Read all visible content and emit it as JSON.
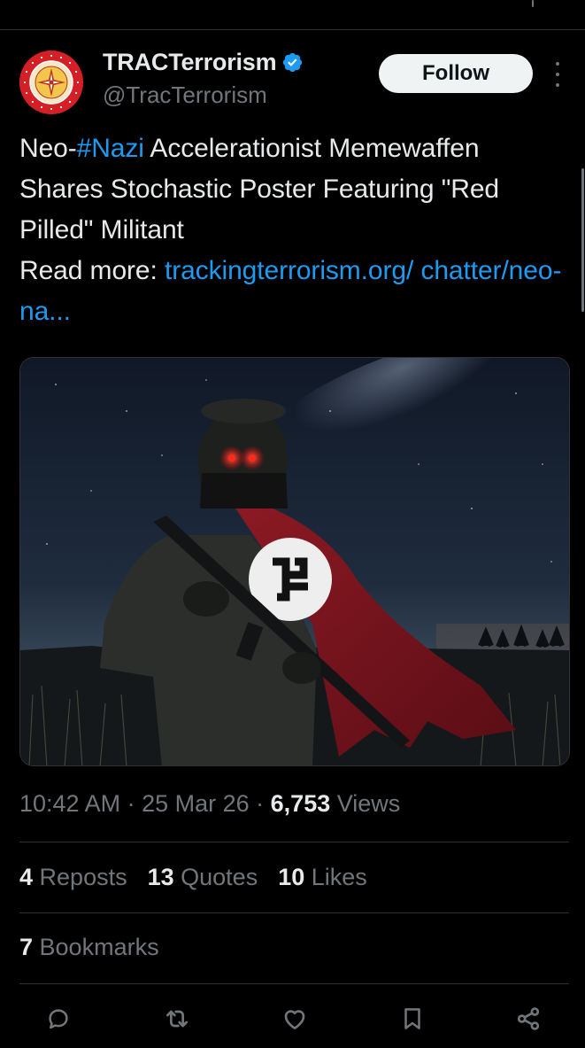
{
  "post": {
    "author": {
      "display_name": "TRACTerrorism",
      "handle": "@TracTerrorism",
      "verified": true,
      "avatar_icon": "trac-seal-logo",
      "avatar_ring_text": "TERRORISM RESEARCH & ANALYSIS CONSORTIUM"
    },
    "follow_label": "Follow",
    "more_icon": "more-vertical-icon",
    "text": {
      "prefix": "Neo-",
      "hashtag": "#Nazi",
      "body": " Accelerationist Memewaffen Shares Stochastic Poster Featuring \"Red Pilled\" Militant",
      "read_more": "Read more:",
      "link_display": "trackingterrorism.org/ chatter/neo-na..."
    },
    "media": {
      "kind": "image"
    },
    "meta": {
      "time": "10:42 AM",
      "sep1": " · ",
      "date": "25 Mar 26",
      "sep2": " · ",
      "views_count": "6,753",
      "views_label": " Views"
    },
    "stats": {
      "reposts_count": "4",
      "reposts_label": " Reposts",
      "quotes_count": "13",
      "quotes_label": " Quotes",
      "likes_count": "10",
      "likes_label": " Likes",
      "bookmarks_count": "7",
      "bookmarks_label": " Bookmarks"
    },
    "actions": [
      "reply-icon",
      "repost-icon",
      "like-icon",
      "bookmark-icon",
      "share-icon"
    ]
  },
  "colors": {
    "background": "#000000",
    "text_primary": "#e7e9ea",
    "text_secondary": "#71767b",
    "link": "#1d9bf0",
    "verified_badge": "#1d9bf0",
    "follow_bg": "#eff3f4",
    "divider": "#2f3336",
    "avatar_red": "#d51f26"
  }
}
